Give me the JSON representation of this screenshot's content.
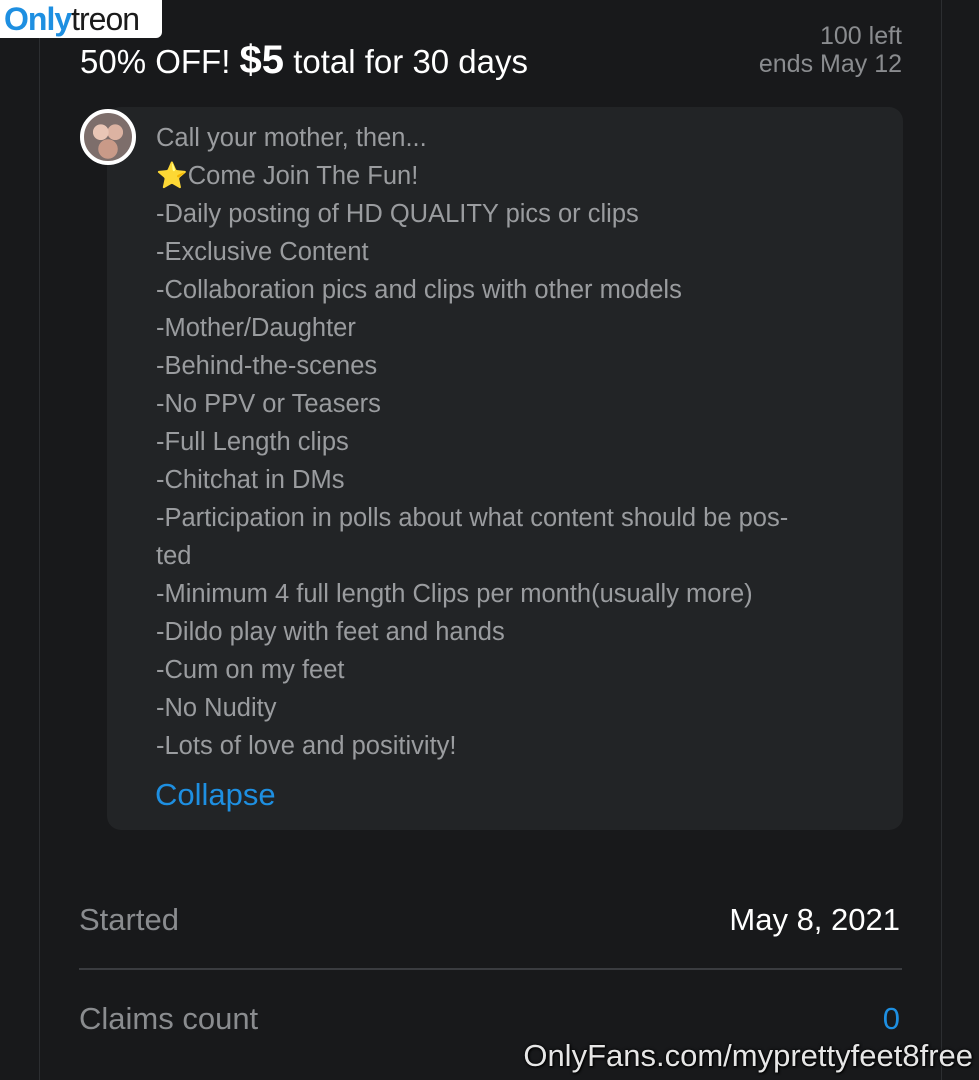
{
  "logo": {
    "part1": "Only",
    "part2": "treon"
  },
  "offer": {
    "title_prefix": "50% OFF! ",
    "price": "$5",
    "title_suffix": " total for 30 days",
    "remaining": "100 left",
    "ends": "ends May 12"
  },
  "description": {
    "lines": [
      "Call your mother, then...",
      "Come Join The Fun!",
      "-Daily posting of HD QUALITY pics or clips",
      "-Exclusive Content",
      "-Collaboration pics and clips with other models",
      "-Mother/Daughter",
      "-Behind-the-scenes",
      "-No PPV or Teasers",
      "-Full Length clips",
      "-Chitchat in DMs",
      "-Participation in polls about what content should be pos-",
      "ted",
      "-Minimum 4 full length Clips per month(usually more)",
      "-Dildo play with feet and hands",
      "-Cum on my feet",
      "-No Nudity",
      "-Lots of love and positivity!"
    ],
    "star": "⭐",
    "collapse_label": "Collapse"
  },
  "stats": {
    "started_label": "Started",
    "started_value": "May 8, 2021",
    "claims_label": "Claims count",
    "claims_value": "0"
  },
  "watermark": "OnlyFans.com/myprettyfeet8free",
  "colors": {
    "background": "#18191b",
    "bubble": "#222426",
    "accent": "#1e8fe1",
    "text_muted": "#8a8c8f",
    "text_primary": "#ffffff"
  }
}
